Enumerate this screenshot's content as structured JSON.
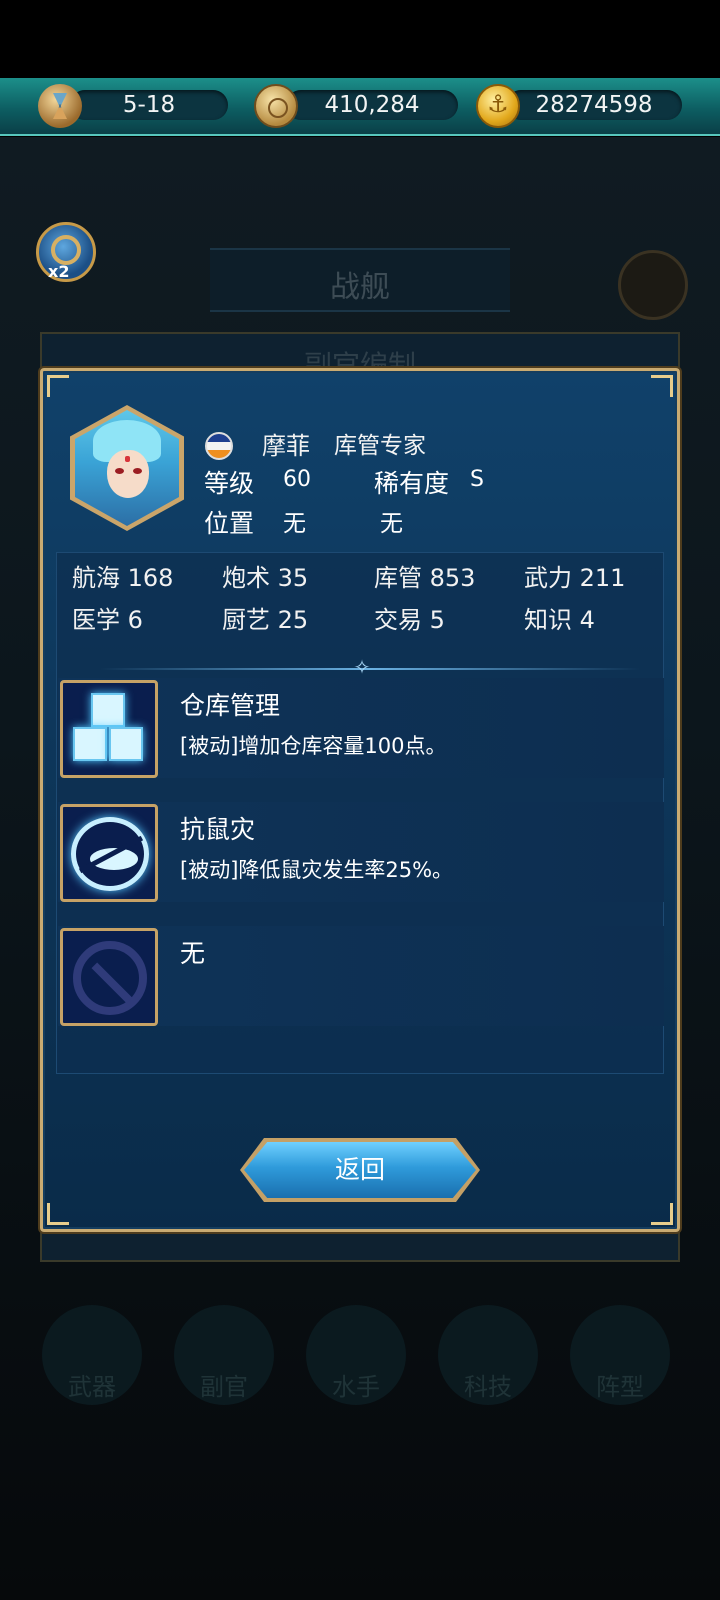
{
  "resources": {
    "stage": "5-18",
    "silver": "410,284",
    "gold": "28274598",
    "icons": [
      "hourglass-icon",
      "compass-coin-icon",
      "anchor-coin-icon"
    ]
  },
  "background": {
    "title": "战舰",
    "panel_title": "副官编制",
    "magnifier_badge": "x2",
    "nav": [
      "武器",
      "副官",
      "水手",
      "科技",
      "阵型"
    ]
  },
  "officer": {
    "name": "摩菲",
    "role": "库管专家",
    "level_label": "等级",
    "level": "60",
    "rarity_label": "稀有度",
    "rarity": "S",
    "position_label": "位置",
    "position": "无",
    "position2": "无",
    "flag_colors": [
      "#1e3f8f",
      "#f3f3f3",
      "#ef8f1f"
    ]
  },
  "stats": [
    {
      "label": "航海 168"
    },
    {
      "label": "炮术 35"
    },
    {
      "label": "库管 853"
    },
    {
      "label": "武力 211"
    },
    {
      "label": "医学 6"
    },
    {
      "label": "厨艺 25"
    },
    {
      "label": "交易 5"
    },
    {
      "label": "知识 4"
    }
  ],
  "skills": [
    {
      "title": "仓库管理",
      "desc": "[被动]增加仓库容量100点。",
      "icon": "warehouse-boxes-icon"
    },
    {
      "title": "抗鼠灾",
      "desc": "[被动]降低鼠灾发生率25%。",
      "icon": "anti-rat-icon"
    },
    {
      "title": "无",
      "desc": "",
      "icon": "empty-slot-icon"
    }
  ],
  "buttons": {
    "return": "返回"
  },
  "colors": {
    "dialog_bg": "#0d3558",
    "gold_border": "#c9ab72",
    "teal_bar": "#1c8f8a"
  }
}
